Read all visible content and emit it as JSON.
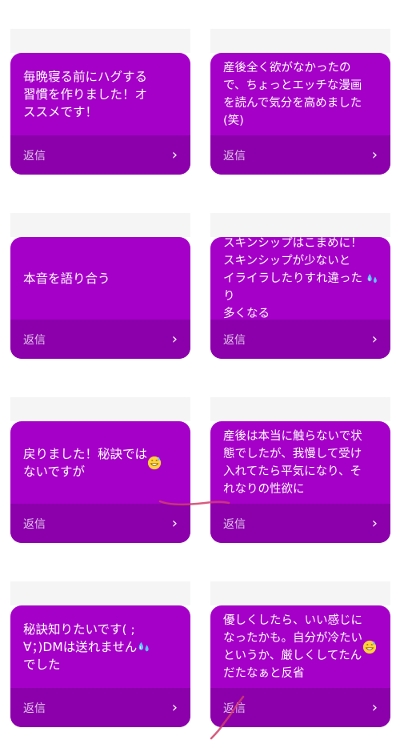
{
  "colors": {
    "card_bg": "#a500c8",
    "reply_bar_bg": "#8b00ab",
    "reply_text": "#e0c4ea",
    "pen_stroke": "#d0406a"
  },
  "reply_label": "返信",
  "cards": [
    {
      "text": "毎晩寝る前にハグする\n習慣を作りました！オ\nススメです！",
      "emoji": ""
    },
    {
      "text": "産後全く欲がなかったの\nで、ちょっとエッチな漫画\nを読んで気分を高めました\n(笑)",
      "emoji": ""
    },
    {
      "text": "本音を語り合う",
      "emoji": ""
    },
    {
      "text": "スキンシップはこまめに！\nスキンシップが少ないと\nイライラしたりすれ違ったり\n多くなる",
      "emoji": "sweat-droplets"
    },
    {
      "text": "戻りました！秘訣では\nないですが",
      "emoji": "grinning-sweat"
    },
    {
      "text": "産後は本当に触らないで状\n態でしたが、我慢して受け\n入れてたら平気になり、そ\nれなりの性欲に",
      "emoji": ""
    },
    {
      "text": "秘訣知りたいです(  ;\n∀；)DMは送れません\nでした",
      "emoji": "sweat-droplets"
    },
    {
      "text": "優しくしたら、いい感じに\nなったかも。自分が冷たい\nというか、厳しくしてたん\nだたなぁと反省",
      "emoji": "grinning-sweat"
    }
  ],
  "icons": {
    "chevron": "chevron-right-icon"
  }
}
